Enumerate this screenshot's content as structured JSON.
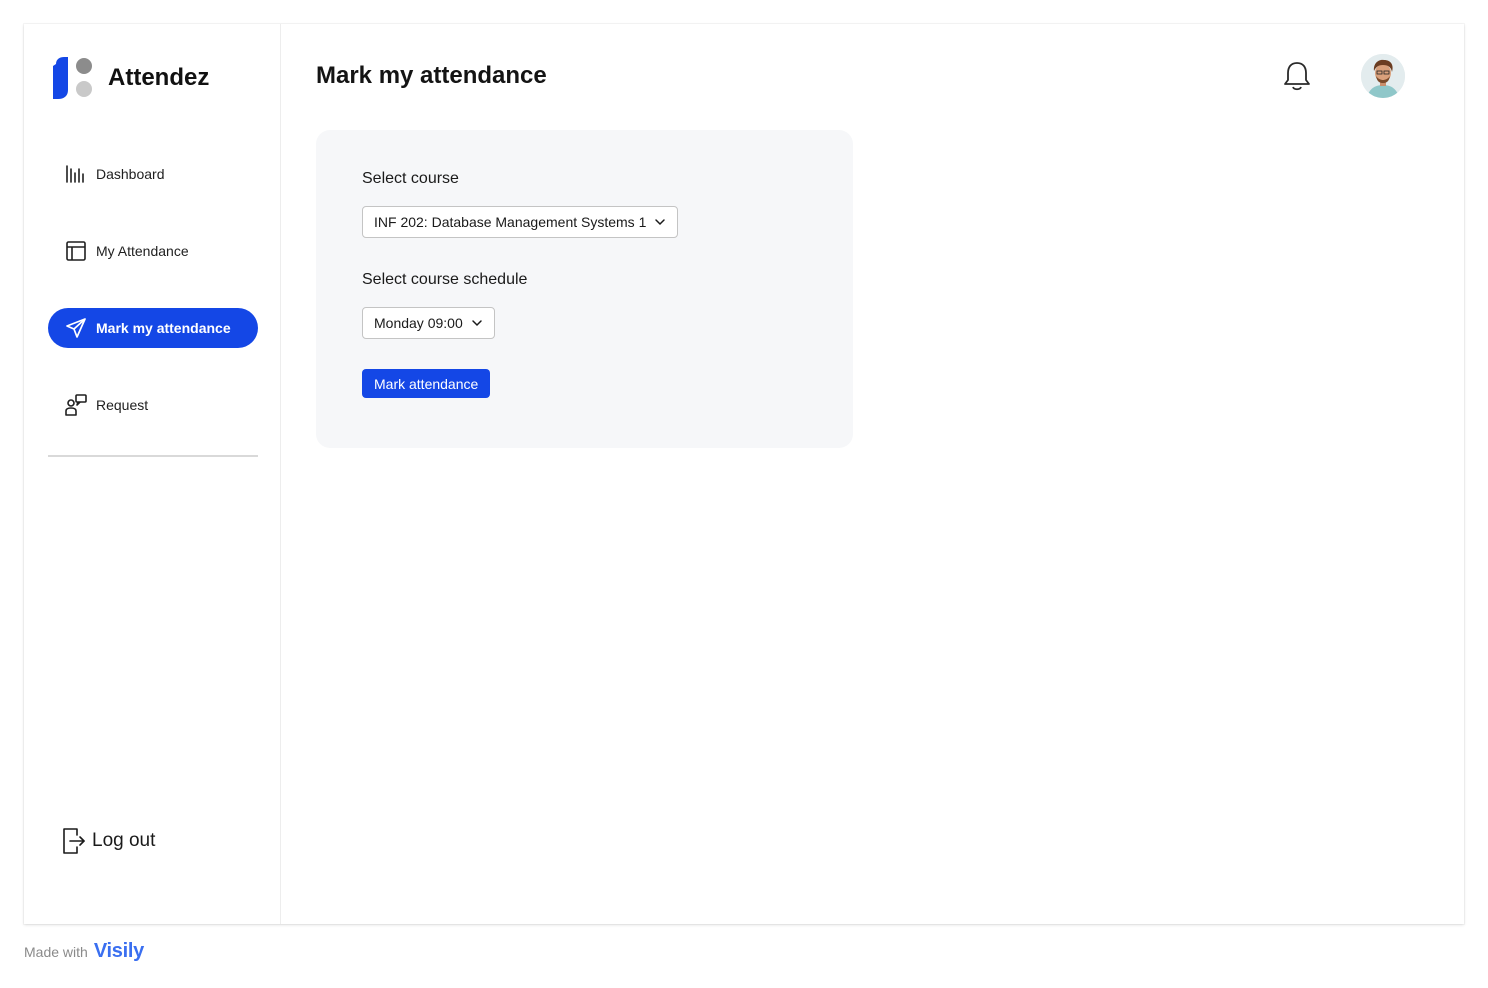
{
  "app": {
    "name": "Attendez"
  },
  "sidebar": {
    "items": [
      {
        "label": "Dashboard",
        "icon": "bar-chart-icon"
      },
      {
        "label": "My Attendance",
        "icon": "calendar-table-icon"
      },
      {
        "label": "Mark my attendance",
        "icon": "send-icon",
        "active": true
      },
      {
        "label": "Request",
        "icon": "request-icon"
      }
    ],
    "logout_label": "Log out"
  },
  "header": {
    "title": "Mark my attendance"
  },
  "form": {
    "course_label": "Select course",
    "course_value": "INF 202: Database Management Systems 1",
    "schedule_label": "Select course schedule",
    "schedule_value": "Monday 09:00",
    "submit_label": "Mark attendance"
  },
  "footer": {
    "made_with": "Made with",
    "brand": "Visily"
  },
  "colors": {
    "accent": "#1447e6",
    "card_bg": "#f6f7f9"
  }
}
